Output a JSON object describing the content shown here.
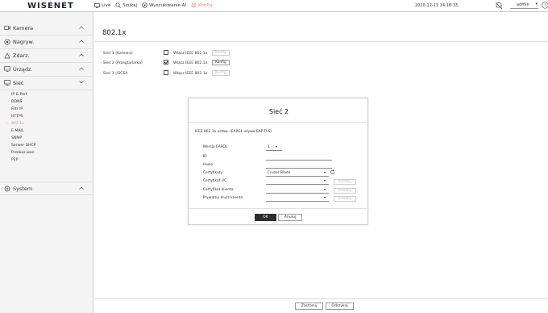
{
  "header": {
    "logo": "WISENET",
    "nav": [
      {
        "label": "Live",
        "icon": "monitor-icon"
      },
      {
        "label": "Szukaj",
        "icon": "search-icon"
      },
      {
        "label": "Wyszukiwanie AI",
        "icon": "ai-search-icon"
      },
      {
        "label": "Konfig",
        "icon": "settings-icon"
      }
    ],
    "datetime": "2020-12-11 14:18:33",
    "user": "admin",
    "accent_color": "#f08a7a"
  },
  "sidebar": {
    "items": [
      {
        "label": "Kamera",
        "icon": "camera-icon"
      },
      {
        "label": "Nagryw.",
        "icon": "record-icon"
      },
      {
        "label": "Zdarz.",
        "icon": "event-icon"
      },
      {
        "label": "Urządz.",
        "icon": "device-icon"
      },
      {
        "label": "Sieć",
        "icon": "network-icon"
      },
      {
        "label": "System",
        "icon": "system-icon"
      }
    ],
    "network_subitems": [
      "IP & Port",
      "DDNS",
      "Filtr IP",
      "HTTPS",
      "802.1x",
      "E-MAIL",
      "SNMP",
      "Serwer DHCP",
      "Przekaz.wan",
      "P2P"
    ],
    "active_subitem": "802.1x"
  },
  "main": {
    "title": "802.1x",
    "networks": [
      {
        "name": "Sieć 1 (Kamera)",
        "enable_label": "Włącz IEEE 802.1x",
        "checked": false,
        "config_label": "Konfig"
      },
      {
        "name": "Sieć 2 (Przeglądarka)",
        "enable_label": "Włącz IEEE 802.1x",
        "checked": true,
        "config_label": "Konfig"
      },
      {
        "name": "Sieć 3 (iSCSI)",
        "enable_label": "Włącz IEEE 802.1x",
        "checked": false,
        "config_label": "Konfig"
      }
    ],
    "apply_label": "Zastosuj",
    "cancel_label": "Odrzykaj"
  },
  "modal": {
    "title": "Sieć 2",
    "description": "IEEE 802.1x ustaw. (EAPOL używa EAP-TLS)",
    "fields": {
      "eapol_label": "Wersja EAPOL",
      "eapol_value": "1",
      "id_label": "ID",
      "password_label": "Hasło",
      "certs_label": "Certyfikaty",
      "certs_value": "Cruzer Blade",
      "ca_cert_label": "Certyfikat UC",
      "client_cert_label": "Certyfikat klienta",
      "private_key_label": "Prywatny klucz klienta",
      "install_label": "Instaluj"
    },
    "ok_label": "OK",
    "cancel_label": "Anuluj"
  }
}
